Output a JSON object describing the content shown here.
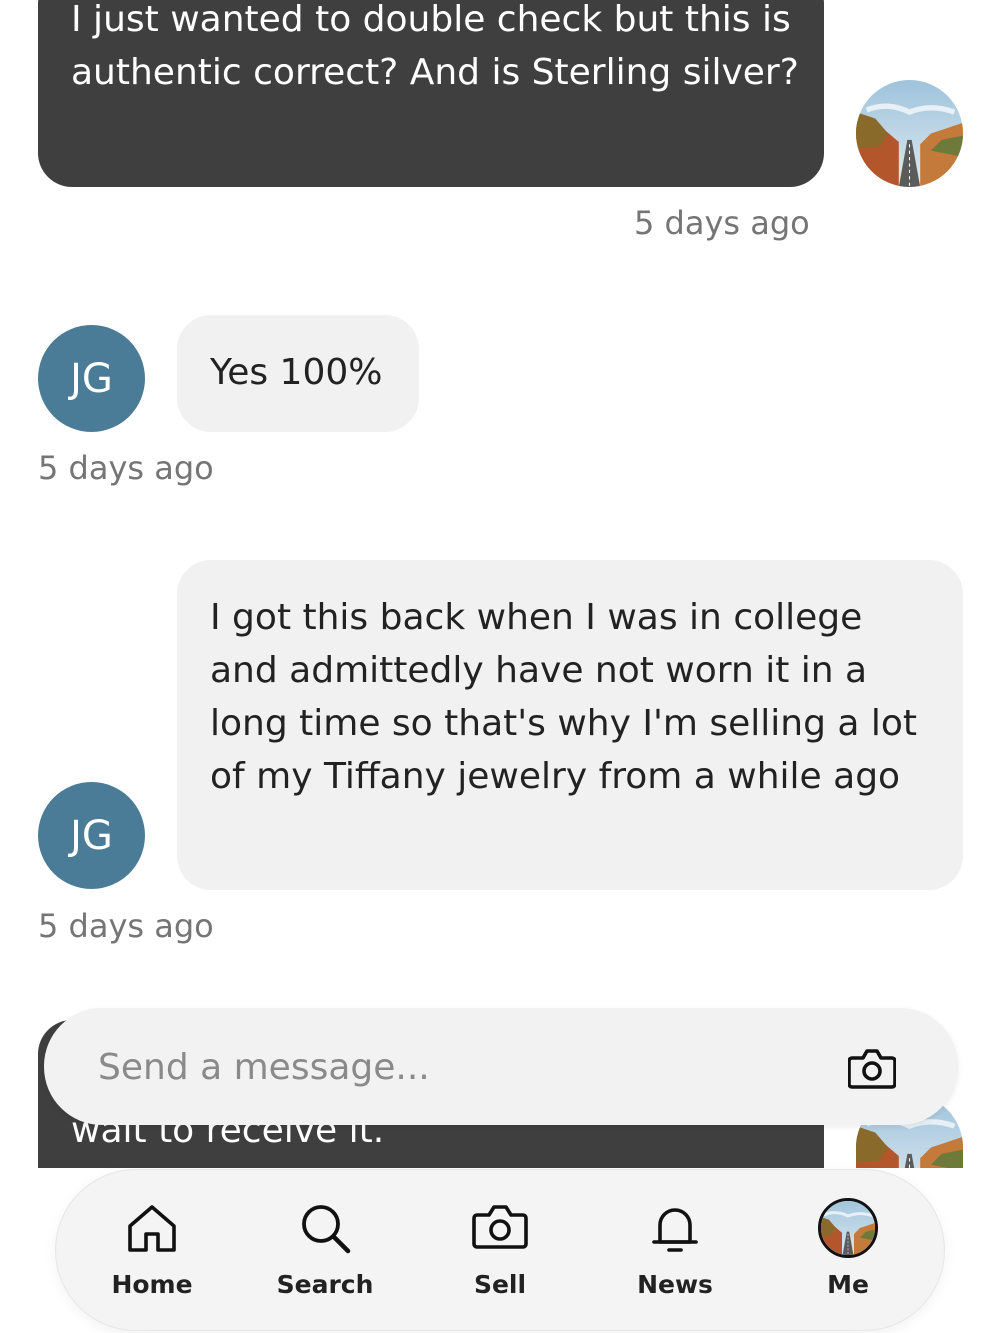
{
  "messages": [
    {
      "text": "I just wanted to double check but this is authentic correct? And is Sterling silver?",
      "time": "5 days ago"
    },
    {
      "text": "Yes 100%",
      "time": "5 days ago",
      "initials": "JG"
    },
    {
      "text": "I got this back when I was in college and admittedly have not worn it in a long time so that's why I'm selling a lot of my Tiffany jewelry from a while ago",
      "time": "5 days ago",
      "initials": "JG"
    },
    {
      "text": "wait to receive it."
    }
  ],
  "composer": {
    "placeholder": "Send a message..."
  },
  "nav": {
    "home": "Home",
    "search": "Search",
    "sell": "Sell",
    "news": "News",
    "me": "Me"
  },
  "colors": {
    "outgoing_bubble": "#3f3f3f",
    "incoming_bubble": "#f1f1f1",
    "avatar_jg": "#4a7c98"
  }
}
